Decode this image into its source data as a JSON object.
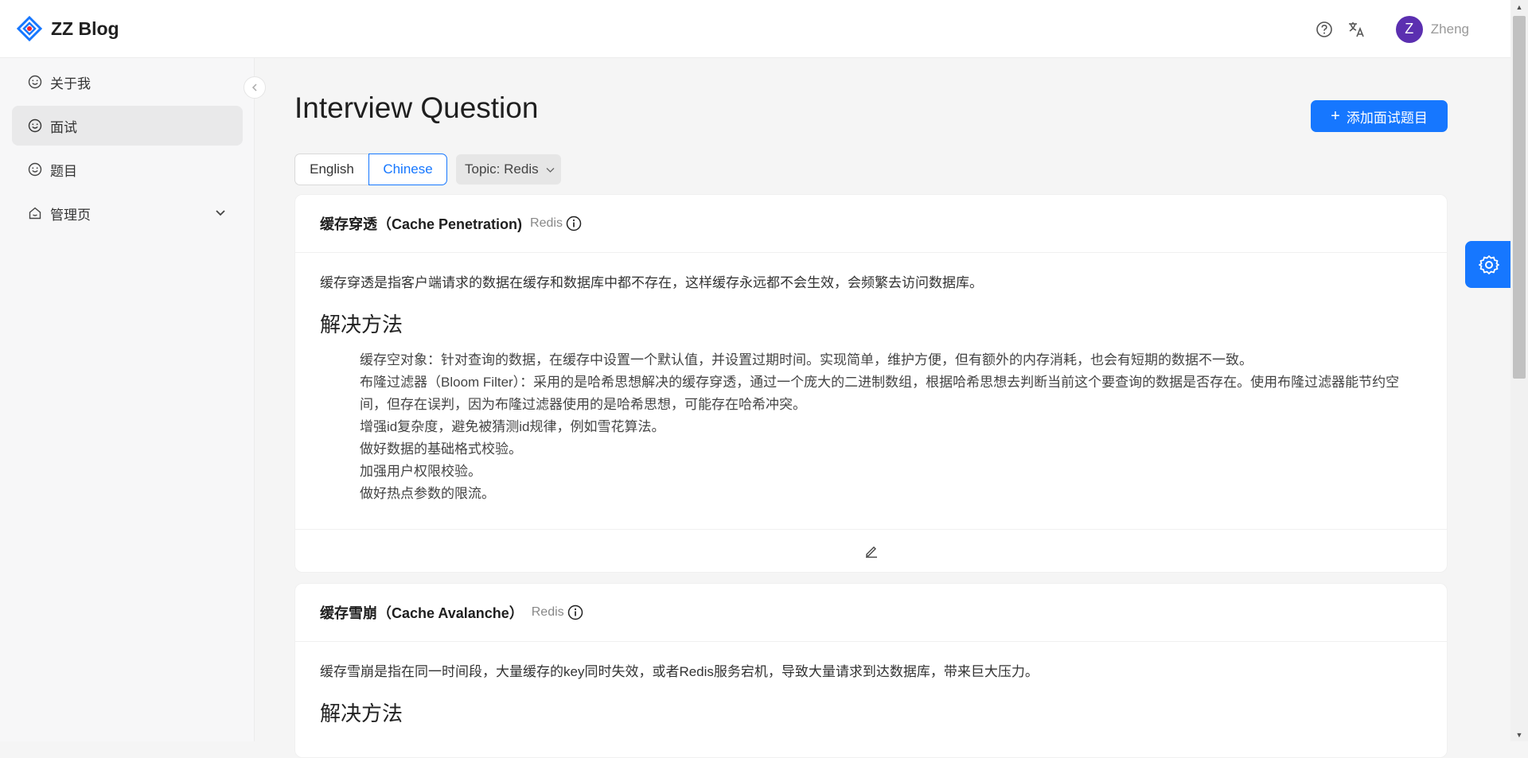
{
  "app": {
    "title": "ZZ Blog",
    "user": {
      "initial": "Z",
      "name": "Zheng"
    }
  },
  "header": {
    "icons": [
      "help-icon",
      "translate-icon"
    ]
  },
  "sidebar": {
    "items": [
      {
        "label": "关于我",
        "icon": "smile-icon"
      },
      {
        "label": "面试",
        "icon": "smile-icon",
        "active": true
      },
      {
        "label": "题目",
        "icon": "smile-icon"
      },
      {
        "label": "管理页",
        "icon": "home-icon",
        "expandable": true
      }
    ]
  },
  "main": {
    "title": "Interview Question",
    "add_button": "添加面试题目",
    "language_tabs": [
      {
        "label": "English"
      },
      {
        "label": "Chinese",
        "selected": true
      }
    ],
    "topic_filter": "Topic: Redis",
    "questions": [
      {
        "title": "缓存穿透（Cache Penetration)",
        "tag": "Redis",
        "description": "缓存穿透是指客户端请求的数据在缓存和数据库中都不存在，这样缓存永远都不会生效，会频繁去访问数据库。",
        "solution_heading": "解决方法",
        "solutions": [
          "缓存空对象：针对查询的数据，在缓存中设置一个默认值，并设置过期时间。实现简单，维护方便，但有额外的内存消耗，也会有短期的数据不一致。",
          "布隆过滤器（Bloom Filter）：采用的是哈希思想解决的缓存穿透，通过一个庞大的二进制数组，根据哈希思想去判断当前这个要查询的数据是否存在。使用布隆过滤器能节约空间，但存在误判，因为布隆过滤器使用的是哈希思想，可能存在哈希冲突。",
          "增强id复杂度，避免被猜测id规律，例如雪花算法。",
          "做好数据的基础格式校验。",
          "加强用户权限校验。",
          "做好热点参数的限流。"
        ]
      },
      {
        "title": "缓存雪崩（Cache Avalanche）",
        "tag": "Redis",
        "description": "缓存雪崩是指在同一时间段，大量缓存的key同时失效，或者Redis服务宕机，导致大量请求到达数据库，带来巨大压力。",
        "solution_heading": "解决方法"
      }
    ]
  },
  "colors": {
    "primary": "#1677ff",
    "avatar": "#5b2fb0"
  }
}
